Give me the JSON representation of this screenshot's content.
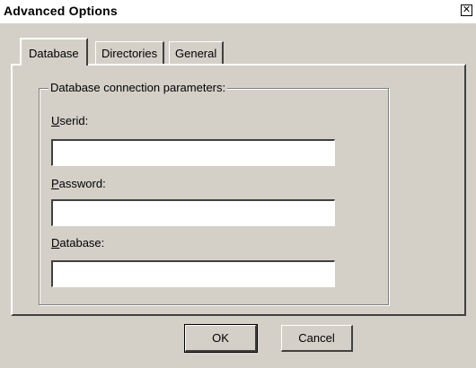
{
  "window": {
    "title": "Advanced Options",
    "close_glyph": "✕"
  },
  "tabs": [
    {
      "label": "Database",
      "active": true
    },
    {
      "label": "Directories",
      "active": false
    },
    {
      "label": "General",
      "active": false
    }
  ],
  "group": {
    "title": "Database connection parameters:"
  },
  "fields": {
    "userid": {
      "mnemonic": "U",
      "rest": "serid:",
      "value": ""
    },
    "password": {
      "mnemonic": "P",
      "rest": "assword:",
      "value": ""
    },
    "database": {
      "mnemonic": "D",
      "rest": "atabase:",
      "value": ""
    }
  },
  "buttons": {
    "ok": "OK",
    "cancel": "Cancel"
  },
  "colors": {
    "face": "#d4d0c8",
    "highlight": "#ffffff",
    "shadow": "#404040"
  }
}
